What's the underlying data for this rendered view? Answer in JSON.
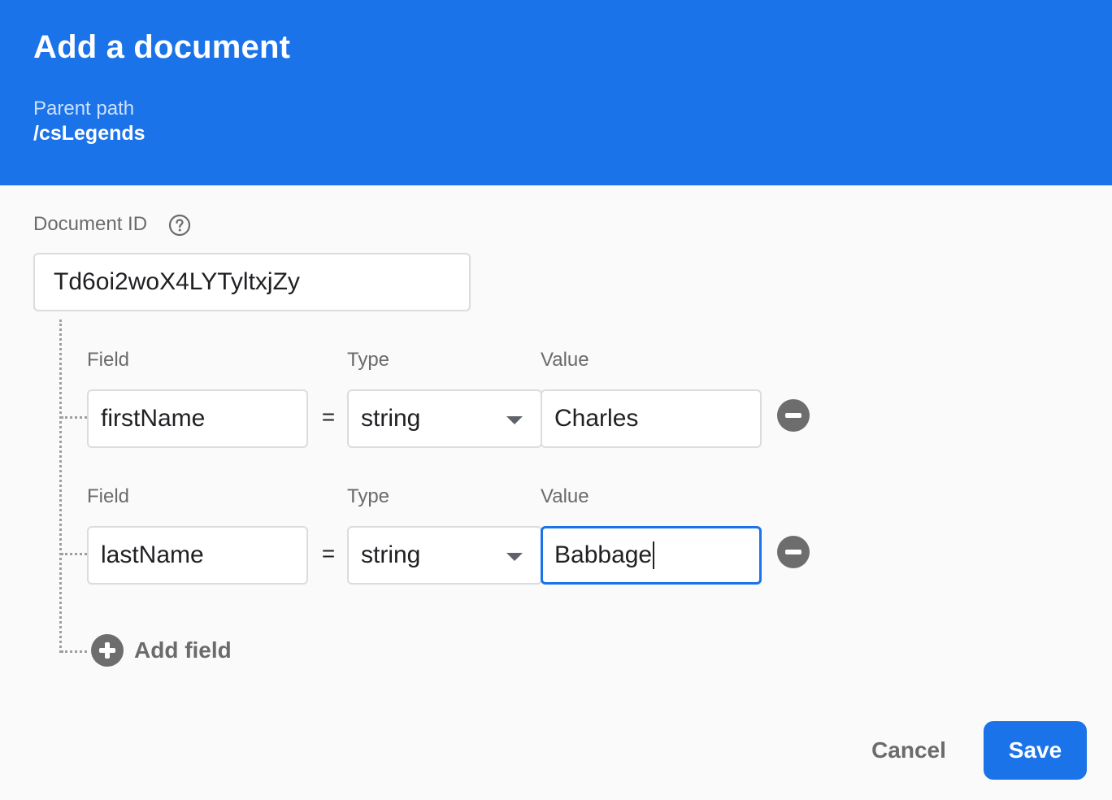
{
  "dialog": {
    "title": "Add a document",
    "parent_path_label": "Parent path",
    "parent_path_value": "/csLegends"
  },
  "document_id": {
    "label": "Document ID",
    "value": "Td6oi2woX4LYTyltxjZy",
    "help_icon": "help-circle-icon"
  },
  "fields": [
    {
      "field_label": "Field",
      "type_label": "Type",
      "value_label": "Value",
      "name": "firstName",
      "equals": "=",
      "type": "string",
      "value": "Charles"
    },
    {
      "field_label": "Field",
      "type_label": "Type",
      "value_label": "Value",
      "name": "lastName",
      "equals": "=",
      "type": "string",
      "value": "Babbage"
    }
  ],
  "add_field_label": "Add field",
  "actions": {
    "cancel_label": "Cancel",
    "save_label": "Save"
  },
  "colors": {
    "primary": "#1a73e8",
    "icon_gray": "#6d6d6d"
  }
}
